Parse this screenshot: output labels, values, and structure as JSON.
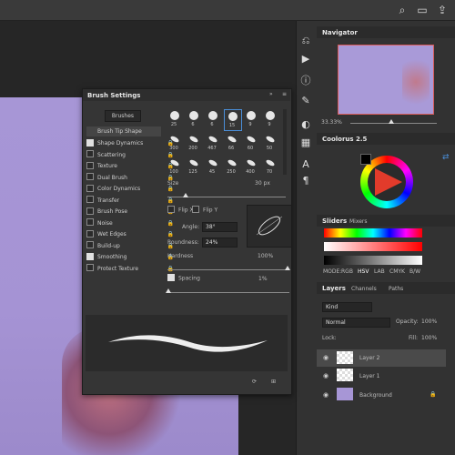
{
  "brush_settings": {
    "title": "Brush Settings",
    "brushes_button": "Brushes",
    "tip_shape_label": "Brush Tip Shape",
    "options": [
      {
        "label": "Shape Dynamics",
        "checked": true
      },
      {
        "label": "Scattering",
        "checked": false
      },
      {
        "label": "Texture",
        "checked": false
      },
      {
        "label": "Dual Brush",
        "checked": false
      },
      {
        "label": "Color Dynamics",
        "checked": false
      },
      {
        "label": "Transfer",
        "checked": false
      },
      {
        "label": "Brush Pose",
        "checked": false
      },
      {
        "label": "Noise",
        "checked": false
      },
      {
        "label": "Wet Edges",
        "checked": false
      },
      {
        "label": "Build-up",
        "checked": false
      },
      {
        "label": "Smoothing",
        "checked": true
      },
      {
        "label": "Protect Texture",
        "checked": false
      }
    ],
    "tip_sizes_row1": [
      "25",
      "6",
      "6",
      "15",
      "9",
      "9"
    ],
    "tip_sizes_row2": [
      "300",
      "200",
      "467",
      "66",
      "60",
      "50"
    ],
    "tip_sizes_row3": [
      "100",
      "125",
      "45",
      "250",
      "400",
      "70"
    ],
    "size_label": "Size",
    "size_value": "30 px",
    "flip_x": "Flip X",
    "flip_y": "Flip Y",
    "angle_label": "Angle:",
    "angle_value": "38°",
    "roundness_label": "Roundness:",
    "roundness_value": "24%",
    "hardness_label": "Hardness",
    "hardness_value": "100%",
    "spacing_label": "Spacing",
    "spacing_value": "1%"
  },
  "navigator": {
    "title": "Navigator",
    "zoom": "33.33%"
  },
  "colorus": {
    "title": "Coolorus 2.5"
  },
  "sliders": {
    "tab_sliders": "Sliders",
    "tab_mixers": "Mixers",
    "mode_label": "MODE:",
    "modes": [
      "RGB",
      "HSV",
      "LAB",
      "CMYK",
      "B/W"
    ]
  },
  "layers": {
    "tabs": [
      "Layers",
      "Channels",
      "Paths"
    ],
    "kind": "Kind",
    "blend_mode": "Normal",
    "opacity_label": "Opacity:",
    "opacity_value": "100%",
    "lock_label": "Lock:",
    "fill_label": "Fill:",
    "fill_value": "100%",
    "items": [
      "Layer 2",
      "Layer 1",
      "Background"
    ]
  },
  "colors": {
    "panel": "#353535",
    "accent": "#4a8ed8",
    "canvas": "#a796d6"
  }
}
